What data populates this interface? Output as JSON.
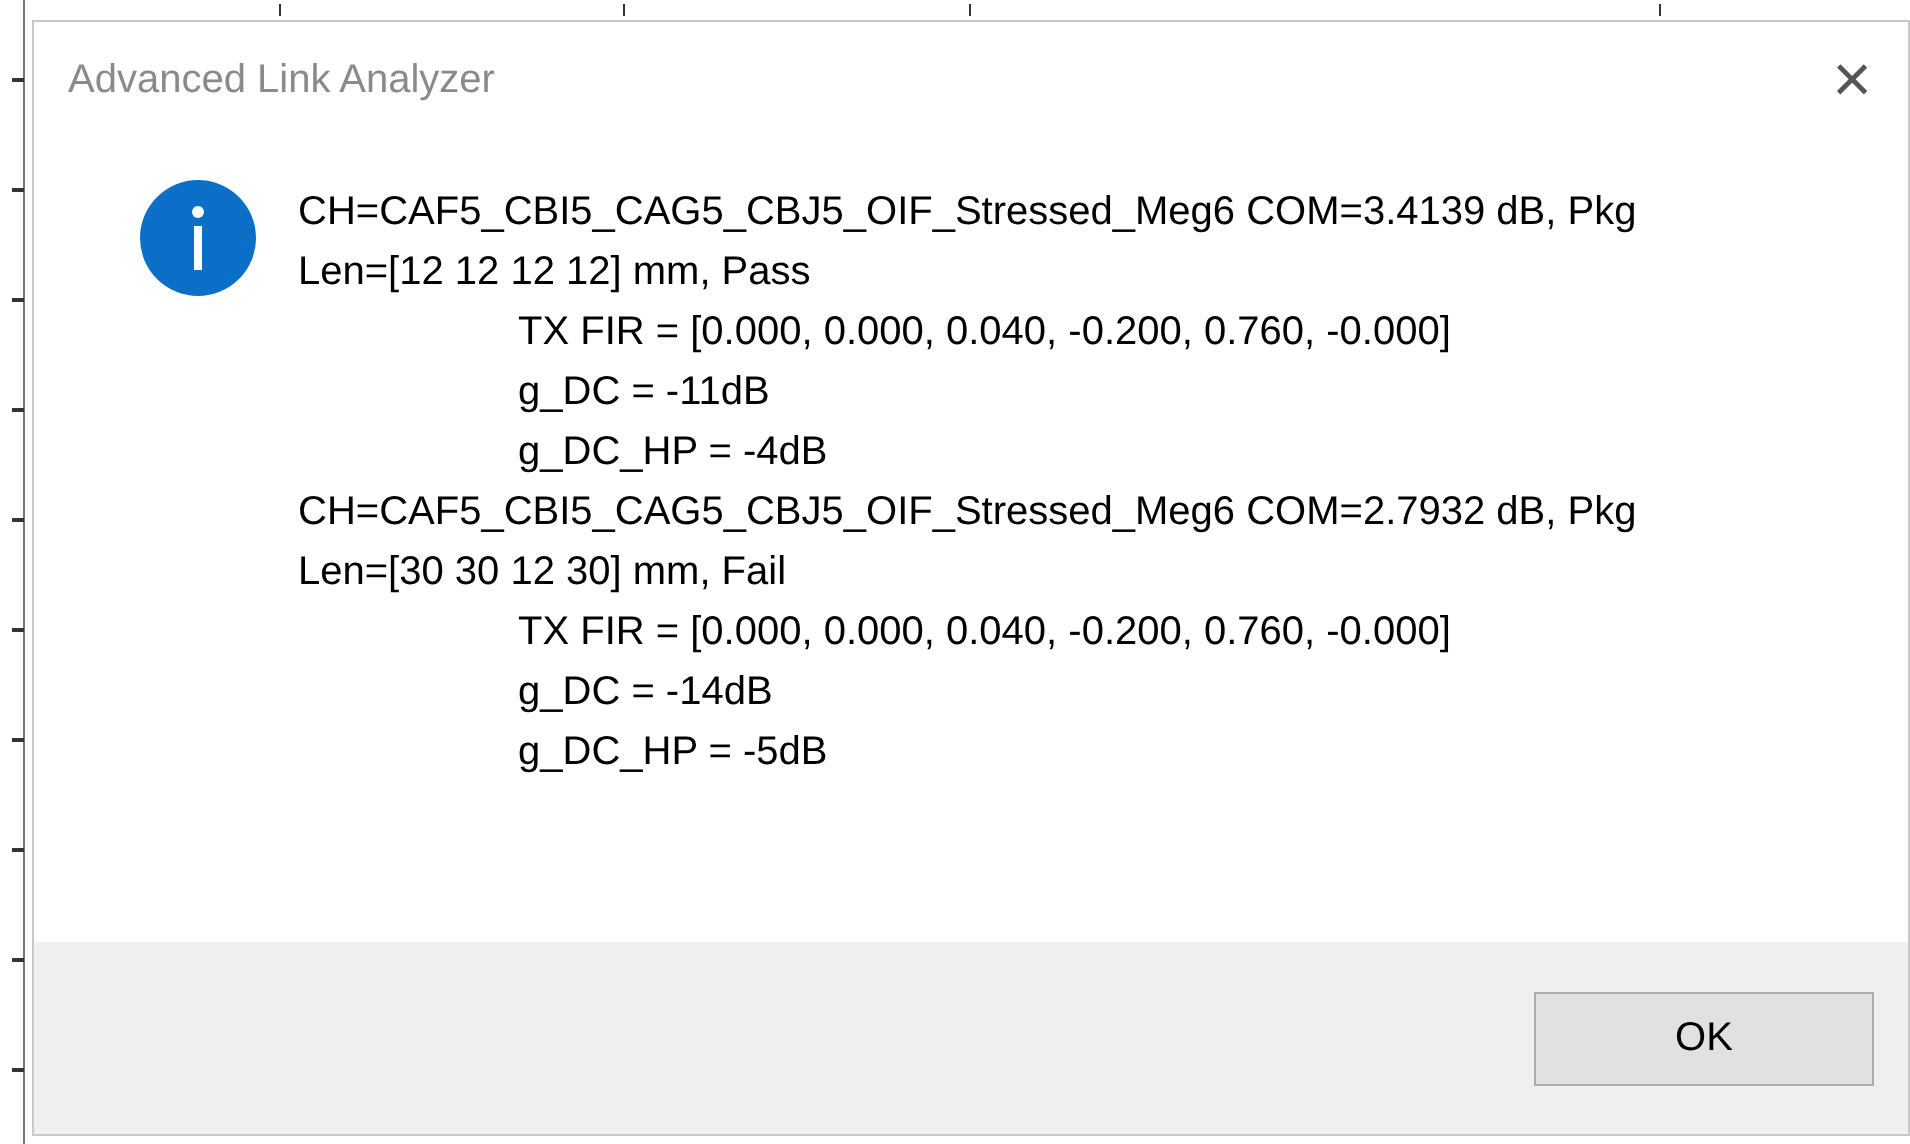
{
  "window": {
    "title": "Advanced Link Analyzer",
    "close": "×"
  },
  "results": [
    {
      "lines": [
        "CH=CAF5_CBI5_CAG5_CBJ5_OIF_Stressed_Meg6 COM=3.4139 dB, Pkg",
        "Len=[12 12 12 12] mm, Pass"
      ],
      "details": [
        "TX FIR = [0.000, 0.000, 0.040, -0.200, 0.760, -0.000]",
        "g_DC = -11dB",
        "g_DC_HP = -4dB"
      ]
    },
    {
      "lines": [
        "CH=CAF5_CBI5_CAG5_CBJ5_OIF_Stressed_Meg6 COM=2.7932 dB, Pkg",
        "Len=[30 30 12 30] mm, Fail"
      ],
      "details": [
        "TX FIR = [0.000, 0.000, 0.040, -0.200, 0.760, -0.000]",
        "g_DC = -14dB",
        "g_DC_HP = -5dB"
      ]
    }
  ],
  "buttons": [
    "OK"
  ]
}
